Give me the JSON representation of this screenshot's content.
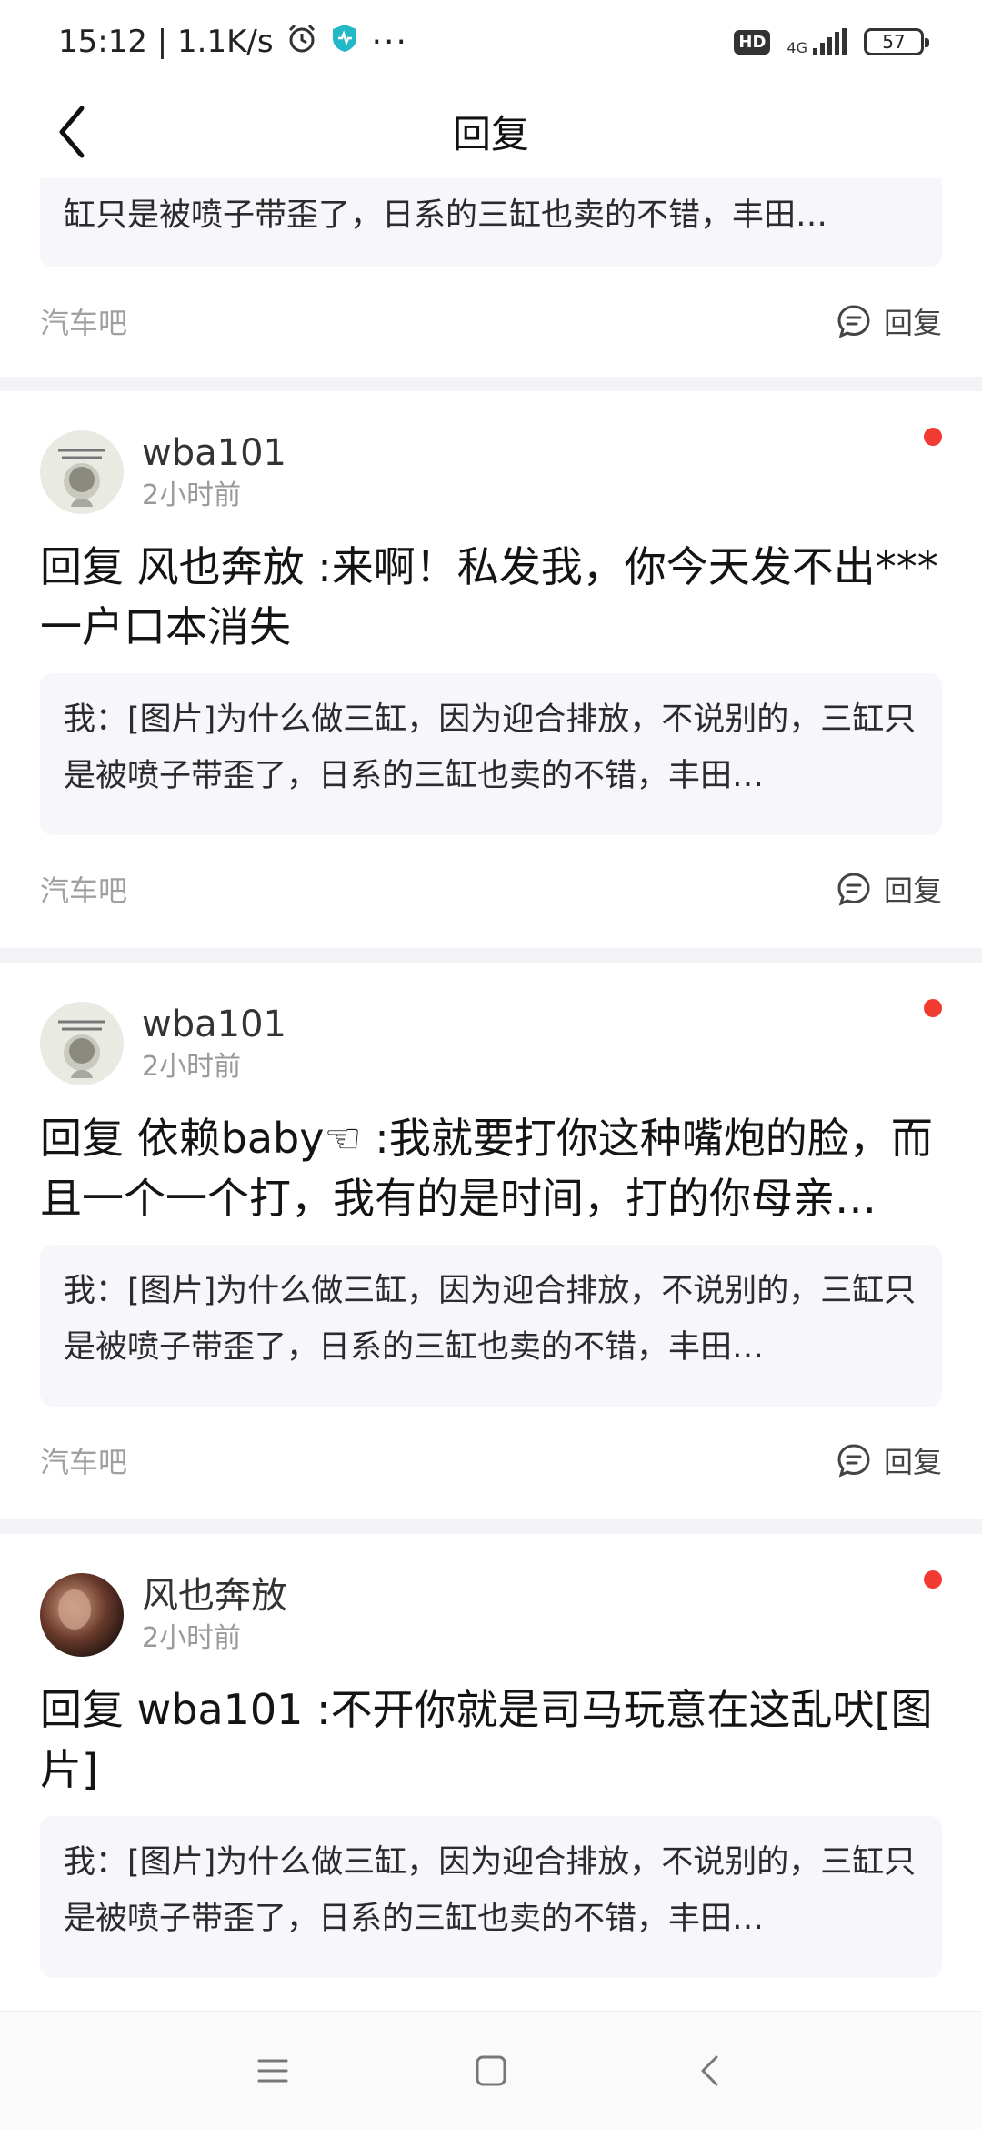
{
  "status_bar": {
    "time_speed": "15:12 | 1.1K/s",
    "more": "···",
    "hd": "HD",
    "network": "4G",
    "battery": "57"
  },
  "nav": {
    "title": "回复"
  },
  "partial_card": {
    "quote": "缸只是被喷子带歪了，日系的三缸也卖的不错，丰田…",
    "forum": "汽车吧",
    "reply_label": "回复"
  },
  "cards": [
    {
      "author": "wba101",
      "time": "2小时前",
      "reply": "回复 风也奔放 :来啊！私发我，你今天发不出***一户口本消失",
      "quote": "我：[图片]为什么做三缸，因为迎合排放，不说别的，三缸只是被喷子带歪了，日系的三缸也卖的不错，丰田…",
      "forum": "汽车吧",
      "reply_label": "回复"
    },
    {
      "author": "wba101",
      "time": "2小时前",
      "reply": "回复 依赖baby☜ :我就要打你这种嘴炮的脸，而且一个一个打，我有的是时间，打的你母亲…",
      "quote": "我：[图片]为什么做三缸，因为迎合排放，不说别的，三缸只是被喷子带歪了，日系的三缸也卖的不错，丰田…",
      "forum": "汽车吧",
      "reply_label": "回复"
    },
    {
      "author": "风也奔放",
      "time": "2小时前",
      "reply": "回复 wba101 :不开你就是司马玩意在这乱吠[图片]",
      "quote": "我：[图片]为什么做三缸，因为迎合排放，不说别的，三缸只是被喷子带歪了，日系的三缸也卖的不错，丰田…"
    }
  ],
  "colors": {
    "unread_dot": "#f23b30",
    "quote_bg": "#f6f6fb",
    "muted_text": "#9a9a9a"
  }
}
